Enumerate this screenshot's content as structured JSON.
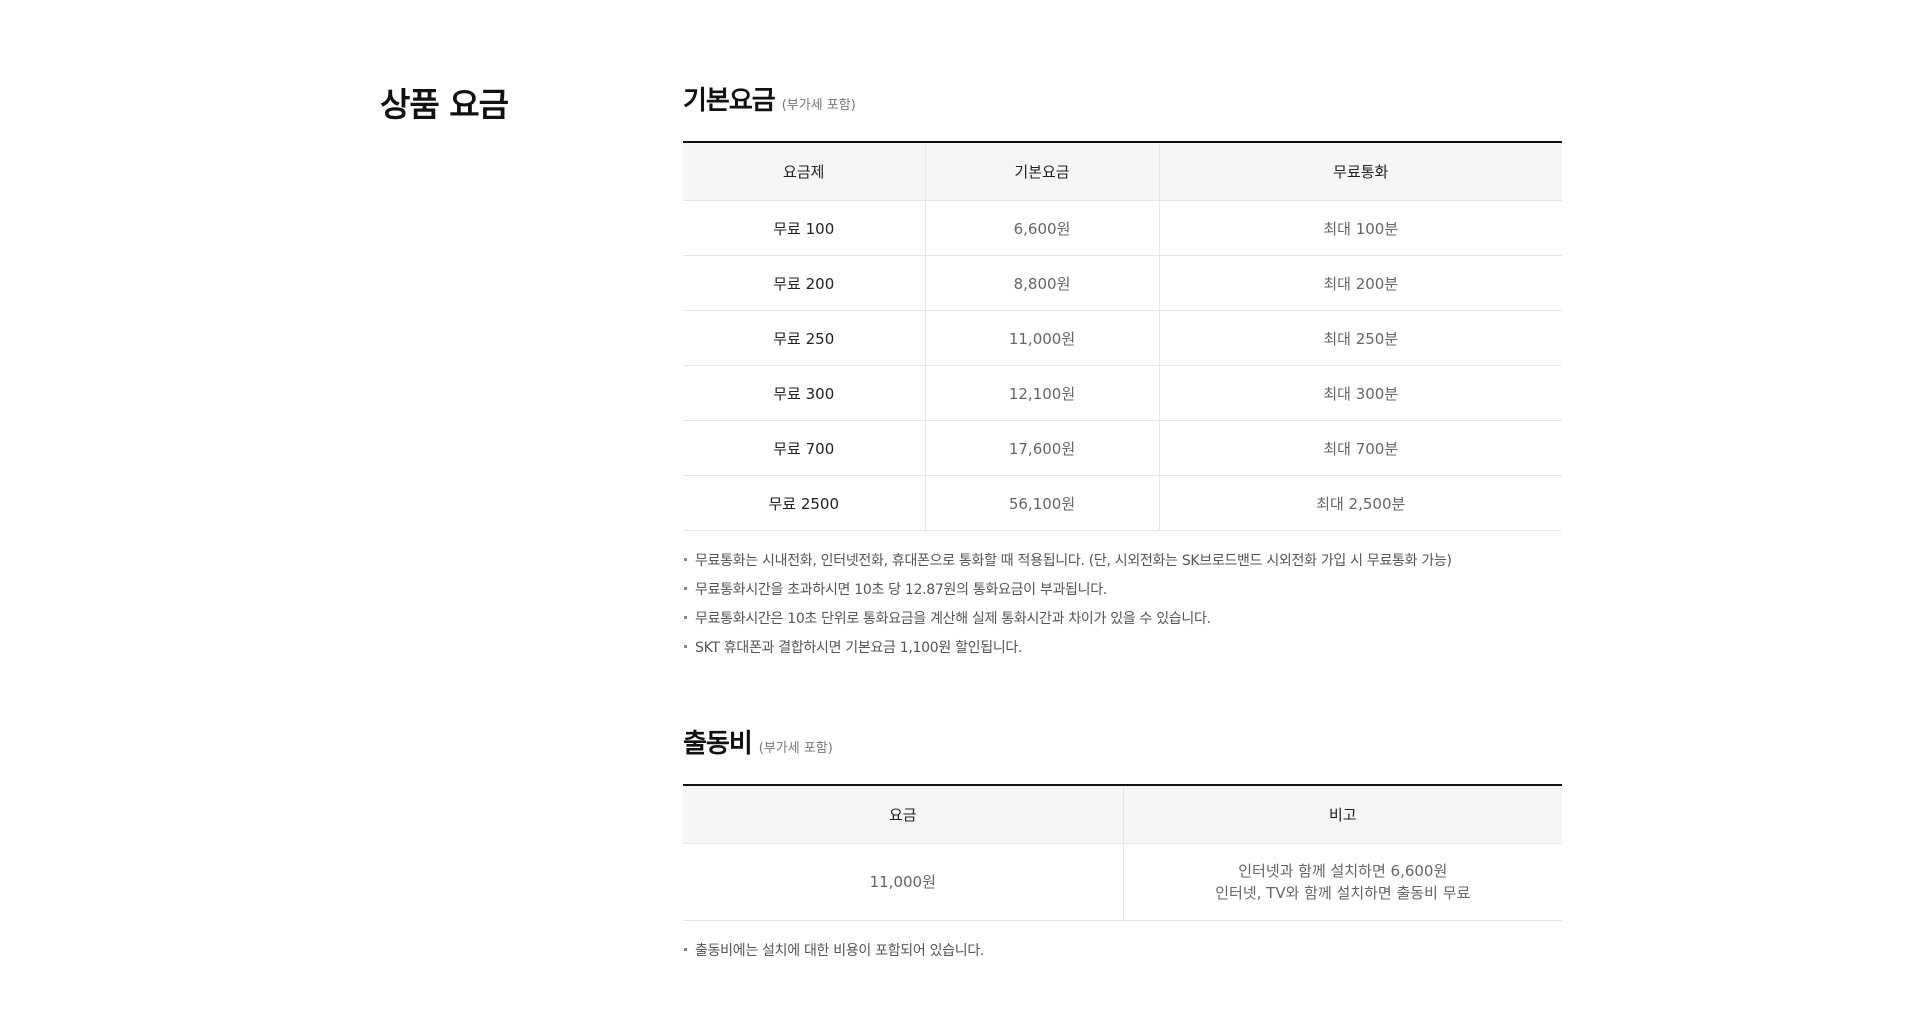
{
  "page_title": "상품 요금",
  "basic_fee": {
    "title": "기본요금",
    "sub": "(부가세 포함)",
    "headers": [
      "요금제",
      "기본요금",
      "무료통화"
    ],
    "rows": [
      [
        "무료 100",
        "6,600원",
        "최대 100분"
      ],
      [
        "무료 200",
        "8,800원",
        "최대 200분"
      ],
      [
        "무료 250",
        "11,000원",
        "최대 250분"
      ],
      [
        "무료 300",
        "12,100원",
        "최대 300분"
      ],
      [
        "무료 700",
        "17,600원",
        "최대 700분"
      ],
      [
        "무료 2500",
        "56,100원",
        "최대 2,500분"
      ]
    ],
    "notes": [
      "무료통화는 시내전화, 인터넷전화, 휴대폰으로 통화할 때 적용됩니다. (단, 시외전화는 SK브로드밴드 시외전화 가입 시 무료통화 가능)",
      "무료통화시간을 초과하시면 10초 당 12.87원의 통화요금이 부과됩니다.",
      "무료통화시간은 10초 단위로 통화요금을 계산해 실제 통화시간과 차이가 있을 수 있습니다.",
      "SKT 휴대폰과 결합하시면 기본요금 1,100원 할인됩니다."
    ]
  },
  "visit_fee": {
    "title": "출동비",
    "sub": "(부가세 포함)",
    "headers": [
      "요금",
      "비고"
    ],
    "row": {
      "fee": "11,000원",
      "remark_line1": "인터넷과 함께 설치하면 6,600원",
      "remark_line2": "인터넷, TV와 함께 설치하면 출동비 무료"
    },
    "notes": [
      "출동비에는 설치에 대한 비용이 포함되어 있습니다."
    ]
  }
}
